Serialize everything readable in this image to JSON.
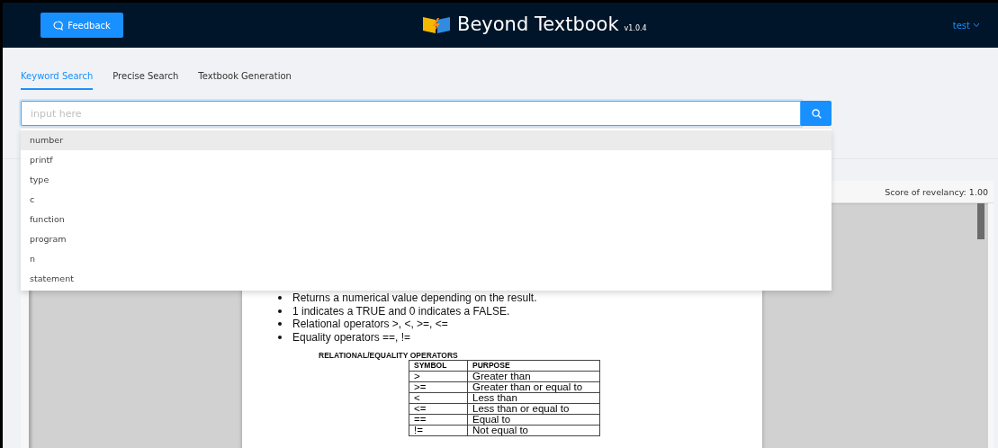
{
  "header": {
    "feedback_button": "Feedback",
    "title": "Beyond Textbook",
    "version": "v1.0.4",
    "user_menu": "test"
  },
  "tabs": [
    {
      "label": "Keyword Search",
      "selected": true
    },
    {
      "label": "Precise Search",
      "selected": false
    },
    {
      "label": "Textbook Generation",
      "selected": false
    }
  ],
  "search": {
    "placeholder": "input here"
  },
  "suggestions": [
    {
      "text": "number",
      "selected": true
    },
    {
      "text": "printf",
      "selected": false
    },
    {
      "text": "type",
      "selected": false
    },
    {
      "text": "c",
      "selected": false
    },
    {
      "text": "function",
      "selected": false
    },
    {
      "text": "program",
      "selected": false
    },
    {
      "text": "n",
      "selected": false
    },
    {
      "text": "statement",
      "selected": false
    }
  ],
  "result": {
    "score": "Score of revelancy: 1.00"
  },
  "document": {
    "bullets": [
      "Returns a numerical value depending on the result.",
      "1 indicates a TRUE and 0 indicates a FALSE.",
      "Relational operators >, <, >=, <=",
      "Equality operators ==, !="
    ],
    "table_title": "RELATIONAL/EQUALITY OPERATORS",
    "table": {
      "columns": [
        "SYMBOL",
        "PURPOSE"
      ],
      "rows": [
        [
          ">",
          "Greater than"
        ],
        [
          ">=",
          "Greater than or equal to"
        ],
        [
          "<",
          "Less than"
        ],
        [
          "<=",
          "Less than or equal to"
        ],
        [
          "==",
          "Equal to"
        ],
        [
          "!=",
          "Not equal to"
        ]
      ]
    }
  }
}
